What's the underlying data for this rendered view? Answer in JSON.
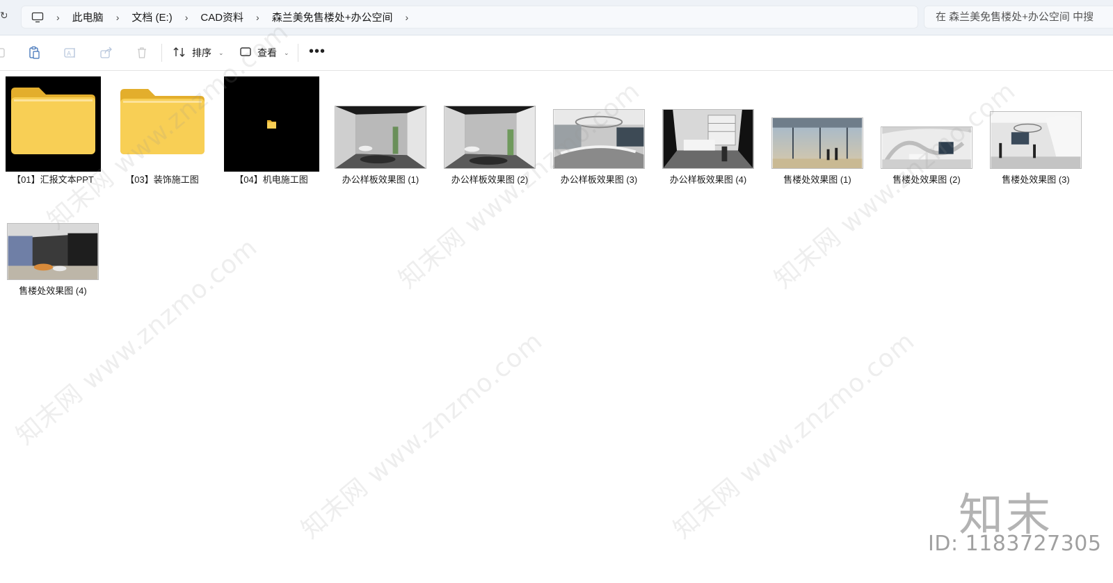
{
  "breadcrumb": {
    "items": [
      "此电脑",
      "文档 (E:)",
      "CAD资料",
      "森兰美免售楼处+办公空间"
    ]
  },
  "search": {
    "placeholder": "在 森兰美免售楼处+办公空间 中搜"
  },
  "toolbar": {
    "sort_label": "排序",
    "view_label": "查看"
  },
  "files": [
    {
      "name": "【01】汇报文本PPT",
      "kind": "folder"
    },
    {
      "name": "【03】装饰施工图",
      "kind": "folder"
    },
    {
      "name": "【04】机电施工图",
      "kind": "folder"
    },
    {
      "name": "办公样板效果图 (1)",
      "kind": "image"
    },
    {
      "name": "办公样板效果图 (2)",
      "kind": "image"
    },
    {
      "name": "办公样板效果图 (3)",
      "kind": "image"
    },
    {
      "name": "办公样板效果图 (4)",
      "kind": "image"
    },
    {
      "name": "售楼处效果图 (1)",
      "kind": "image"
    },
    {
      "name": "售楼处效果图 (2)",
      "kind": "image"
    },
    {
      "name": "售楼处效果图 (3)",
      "kind": "image"
    },
    {
      "name": "售楼处效果图 (4)",
      "kind": "image"
    }
  ],
  "watermark": {
    "text": "知末网 www.znzmo.com",
    "logo": "知末",
    "id": "ID: 1183727305"
  },
  "colors": {
    "folder": "#f6c94a",
    "folder_dark": "#e3ae2c",
    "bar": "#eef2f7"
  },
  "icons": [
    "computer-icon",
    "chevron-right-icon",
    "paste-icon",
    "rename-icon",
    "share-icon",
    "delete-icon",
    "sort-icon",
    "view-icon",
    "more-icon",
    "folder-icon"
  ]
}
